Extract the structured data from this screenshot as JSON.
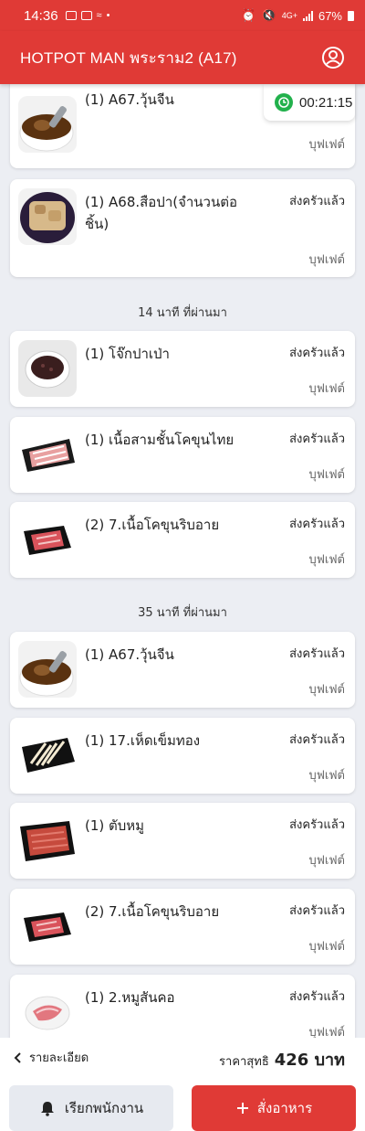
{
  "status_bar": {
    "time": "14:36",
    "network": "4G+",
    "battery": "67%"
  },
  "app": {
    "title": "HOTPOT MAN พระราม2 (A17)",
    "accent": "#e03a36"
  },
  "timer": {
    "value": "00:21:15"
  },
  "orders": [
    {
      "name": "(1) A67.วุ้นจีน",
      "status": "",
      "type": "บุฟเฟต์",
      "image": "soup-bowl"
    },
    {
      "name": "(1) A68.สือปา(จำนวนต่อชิ้น)",
      "status": "ส่งครัวแล้ว",
      "type": "บุฟเฟต์",
      "image": "fried-dish"
    },
    {
      "name": "(1) โจ๊กปาเป่า",
      "status": "ส่งครัวแล้ว",
      "type": "บุฟเฟต์",
      "image": "porridge-bowl"
    },
    {
      "name": "(1) เนื้อสามชั้นโคขุนไทย",
      "status": "ส่งครัวแล้ว",
      "type": "บุฟเฟต์",
      "image": "beef-tray"
    },
    {
      "name": "(2) 7.เนื้อโคขุนริบอาย",
      "status": "ส่งครัวแล้ว",
      "type": "บุฟเฟต์",
      "image": "ribeye-tray"
    },
    {
      "name": "(1) A67.วุ้นจีน",
      "status": "ส่งครัวแล้ว",
      "type": "บุฟเฟต์",
      "image": "soup-bowl"
    },
    {
      "name": "(1) 17.เห็ดเข็มทอง",
      "status": "ส่งครัวแล้ว",
      "type": "บุฟเฟต์",
      "image": "mushroom-tray"
    },
    {
      "name": "(1) ตับหมู",
      "status": "ส่งครัวแล้ว",
      "type": "บุฟเฟต์",
      "image": "liver-tray"
    },
    {
      "name": "(2) 7.เนื้อโคขุนริบอาย",
      "status": "ส่งครัวแล้ว",
      "type": "บุฟเฟต์",
      "image": "ribeye-tray"
    },
    {
      "name": "(1) 2.หมูสันคอ",
      "status": "ส่งครัวแล้ว",
      "type": "บุฟเฟต์",
      "image": "pork-plate"
    }
  ],
  "sections": [
    "14 นาที ที่ผ่านมา",
    "35 นาที ที่ผ่านมา"
  ],
  "footer": {
    "details_label": "รายละเอียด",
    "price_label": "ราคาสุทธิ",
    "price_value": "426 บาท",
    "call_staff_label": "เรียกพนักงาน",
    "order_label": "สั่งอาหาร"
  }
}
